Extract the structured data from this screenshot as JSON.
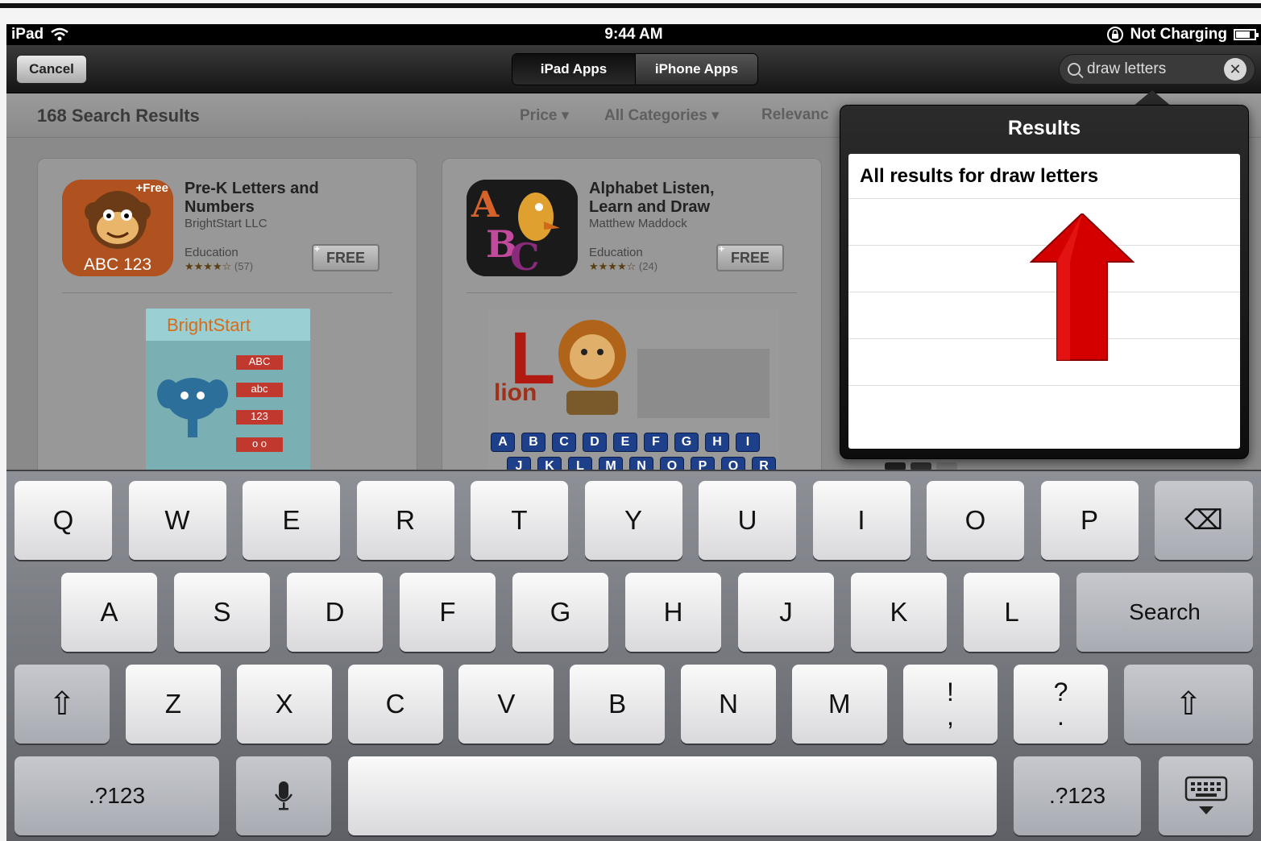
{
  "status": {
    "device": "iPad",
    "time": "9:44 AM",
    "battery_text": "Not Charging"
  },
  "nav": {
    "cancel_label": "Cancel",
    "tabs": [
      "iPad Apps",
      "iPhone Apps"
    ],
    "search_value": "draw letters",
    "clear_glyph": "✕"
  },
  "results": {
    "count_label": "168 Search Results",
    "filters": [
      "Price ▾",
      "All Categories ▾",
      "Relevanc"
    ]
  },
  "apps": [
    {
      "title_line1": "Pre-K Letters and",
      "title_line2": "Numbers",
      "developer": "BrightStart LLC",
      "category": "Education",
      "stars": "★★★★☆",
      "rating_count": "(57)",
      "price_label": "FREE",
      "icon_badge": "+Free",
      "icon_caption": "ABC 123",
      "shot_brand": "BrightStart",
      "shot_tabs": [
        "ABC",
        "abc",
        "123",
        "o o"
      ]
    },
    {
      "title_line1": "Alphabet Listen,",
      "title_line2": "Learn and Draw",
      "developer": "Matthew Maddock",
      "category": "Education",
      "stars": "★★★★☆",
      "rating_count": "(24)",
      "price_label": "FREE",
      "shot_big_letter": "L",
      "shot_word": "lion",
      "shot_letters_row1": [
        "A",
        "B",
        "C",
        "D",
        "E",
        "F",
        "G",
        "H",
        "I"
      ],
      "shot_letters_row2": [
        "J",
        "K",
        "L",
        "M",
        "N",
        "O",
        "P",
        "Q",
        "R"
      ]
    }
  ],
  "popover": {
    "title": "Results",
    "first_row": "All results for draw letters"
  },
  "keyboard": {
    "row1": [
      "Q",
      "W",
      "E",
      "R",
      "T",
      "Y",
      "U",
      "I",
      "O",
      "P"
    ],
    "row2": [
      "A",
      "S",
      "D",
      "F",
      "G",
      "H",
      "J",
      "K",
      "L"
    ],
    "row3": [
      "Z",
      "X",
      "C",
      "V",
      "B",
      "N",
      "M"
    ],
    "search_label": "Search",
    "numbers_label": ".?123",
    "punct1_top": "!",
    "punct1_bottom": ",",
    "punct2_top": "?",
    "punct2_bottom": ".",
    "shift_glyph": "⇧",
    "backspace_glyph": "⌫"
  },
  "colors": {
    "arrow_red": "#d40000",
    "keyboard_bg": "#7a7c83"
  }
}
